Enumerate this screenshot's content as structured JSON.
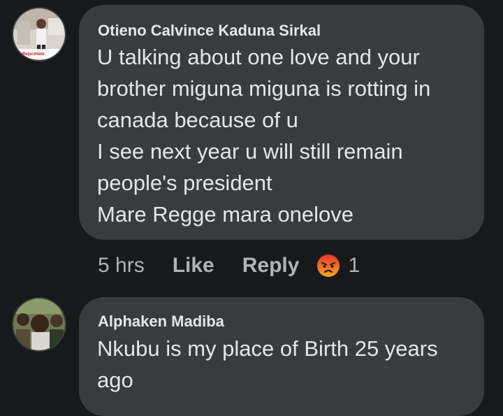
{
  "comments": [
    {
      "author": "Otieno Calvince Kaduna Sirkal",
      "avatar_caption": "#RejectHate",
      "lines": [
        "U talking about one love and your",
        "brother miguna miguna is rotting in",
        "canada because of u",
        "I see next year u will still remain",
        "people's president",
        "Mare Regge mara onelove"
      ],
      "time": "5 hrs",
      "like_label": "Like",
      "reply_label": "Reply",
      "reaction_icon": "angry-reaction-icon",
      "reaction_count": "1"
    },
    {
      "author": "Alphaken Madiba",
      "lines": [
        "Nkubu is my place of Birth 25 years",
        "ago"
      ]
    }
  ],
  "colors": {
    "background": "#18191a",
    "bubble": "#3a3b3c",
    "text": "#e4e6eb",
    "muted": "#b0b3b8",
    "angry": "#f07a2a"
  }
}
